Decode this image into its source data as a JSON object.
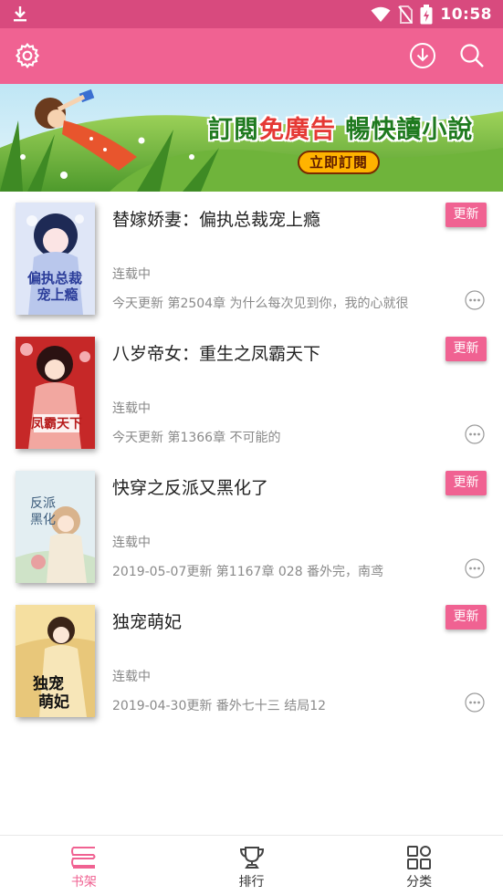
{
  "status_bar": {
    "time": "10:58",
    "icons": [
      "download-icon",
      "wifi-icon",
      "no-sim-icon",
      "battery-charging-icon"
    ]
  },
  "app_bar": {
    "icons": [
      "settings-gear-icon",
      "download-circle-icon",
      "search-icon"
    ]
  },
  "banner": {
    "headline_part1": "訂閱",
    "headline_part2": "免廣告",
    "headline_part3": " 暢快讀小說",
    "cta_label": "立即訂閱"
  },
  "books": [
    {
      "title": "替嫁娇妻：偏执总裁宠上瘾",
      "status": "连载中",
      "latest": "今天更新 第2504章 为什么每次见到你，我的心就很",
      "badge": "更新",
      "cover_text": "偏执总裁宠上瘾"
    },
    {
      "title": "八岁帝女：重生之凤霸天下",
      "status": "连载中",
      "latest": "今天更新 第1366章 不可能的",
      "badge": "更新",
      "cover_text": "凤霸天下"
    },
    {
      "title": "快穿之反派又黑化了",
      "status": "连载中",
      "latest": "2019-05-07更新 第1167章 028 番外完，南鸢",
      "badge": "更新",
      "cover_text": "反派又黑化了"
    },
    {
      "title": "独宠萌妃",
      "status": "连载中",
      "latest": "2019-04-30更新 番外七十三 结局12",
      "badge": "更新",
      "cover_text": "独宠萌妃"
    }
  ],
  "bottom_nav": {
    "items": [
      {
        "label": "书架",
        "icon": "bookshelf-icon",
        "active": true
      },
      {
        "label": "排行",
        "icon": "trophy-icon",
        "active": false
      },
      {
        "label": "分类",
        "icon": "category-grid-icon",
        "active": false
      }
    ]
  },
  "colors": {
    "status_bar": "#d84a7e",
    "app_bar": "#f06292",
    "accent": "#f06292"
  }
}
